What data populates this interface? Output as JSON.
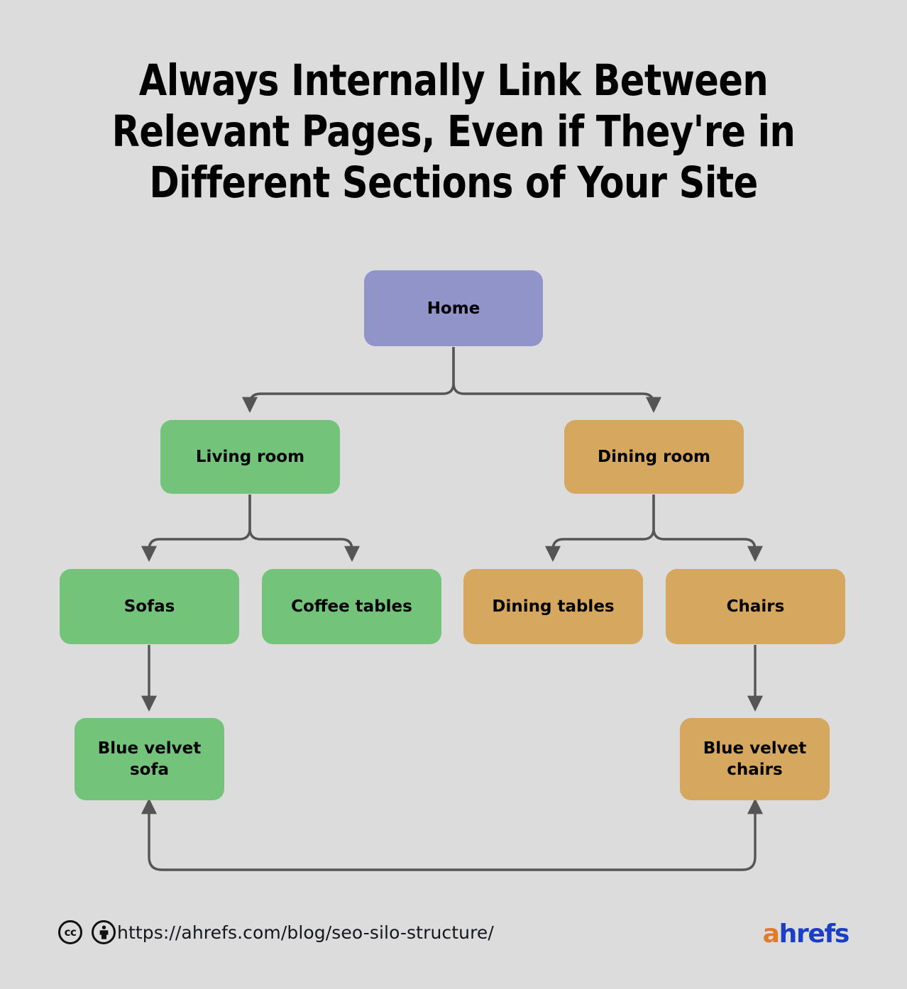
{
  "title": "Always Internally Link Between Relevant Pages, Even if They're in Different Sections of Your Site",
  "colors": {
    "background": "#dcdcdc",
    "node_purple": "#9094c9",
    "node_green": "#74c37b",
    "node_tan": "#d6a75f",
    "edge": "#555555",
    "text": "#000000",
    "brand_orange": "#e07b2a",
    "brand_blue": "#1a3fc4"
  },
  "diagram": {
    "type": "tree",
    "nodes": [
      {
        "id": "home",
        "label": "Home",
        "color": "purple",
        "level": 0
      },
      {
        "id": "living-room",
        "label": "Living room",
        "color": "green",
        "level": 1
      },
      {
        "id": "dining-room",
        "label": "Dining room",
        "color": "tan",
        "level": 1
      },
      {
        "id": "sofas",
        "label": "Sofas",
        "color": "green",
        "level": 2
      },
      {
        "id": "coffee-tables",
        "label": "Coffee tables",
        "color": "green",
        "level": 2
      },
      {
        "id": "dining-tables",
        "label": "Dining tables",
        "color": "tan",
        "level": 2
      },
      {
        "id": "chairs",
        "label": "Chairs",
        "color": "tan",
        "level": 2
      },
      {
        "id": "blue-velvet-sofa",
        "label": "Blue velvet\nsofa",
        "color": "green",
        "level": 3
      },
      {
        "id": "blue-velvet-chairs",
        "label": "Blue velvet\nchairs",
        "color": "tan",
        "level": 3
      }
    ],
    "edges": [
      {
        "from": "home",
        "to": "living-room",
        "style": "elbow",
        "arrows": "end"
      },
      {
        "from": "home",
        "to": "dining-room",
        "style": "elbow",
        "arrows": "end"
      },
      {
        "from": "living-room",
        "to": "sofas",
        "style": "elbow",
        "arrows": "end"
      },
      {
        "from": "living-room",
        "to": "coffee-tables",
        "style": "elbow",
        "arrows": "end"
      },
      {
        "from": "dining-room",
        "to": "dining-tables",
        "style": "elbow",
        "arrows": "end"
      },
      {
        "from": "dining-room",
        "to": "chairs",
        "style": "elbow",
        "arrows": "end"
      },
      {
        "from": "sofas",
        "to": "blue-velvet-sofa",
        "style": "straight",
        "arrows": "end"
      },
      {
        "from": "chairs",
        "to": "blue-velvet-chairs",
        "style": "straight",
        "arrows": "end"
      },
      {
        "from": "blue-velvet-sofa",
        "to": "blue-velvet-chairs",
        "style": "bottom-loop",
        "arrows": "both"
      }
    ]
  },
  "footer": {
    "license_cc": "cc",
    "license_by": "by",
    "url": "https://ahrefs.com/blog/seo-silo-structure/",
    "brand_first": "a",
    "brand_rest": "hrefs"
  }
}
